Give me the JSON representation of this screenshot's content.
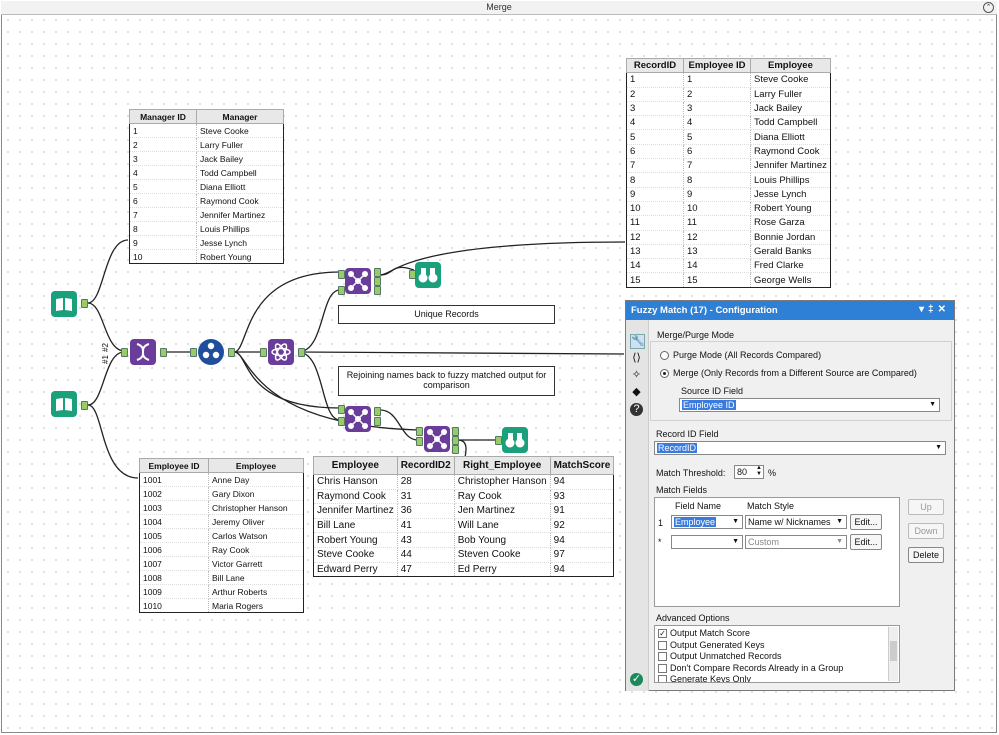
{
  "window": {
    "title": "Merge"
  },
  "manager_table": {
    "headers": [
      "Manager ID",
      "Manager"
    ],
    "rows": [
      [
        "1",
        "Steve Cooke"
      ],
      [
        "2",
        "Larry Fuller"
      ],
      [
        "3",
        "Jack Bailey"
      ],
      [
        "4",
        "Todd Campbell"
      ],
      [
        "5",
        "Diana Elliott"
      ],
      [
        "6",
        "Raymond Cook"
      ],
      [
        "7",
        "Jennifer Martinez"
      ],
      [
        "8",
        "Louis Phillips"
      ],
      [
        "9",
        "Jesse Lynch"
      ],
      [
        "10",
        "Robert Young"
      ]
    ]
  },
  "employee_table": {
    "headers": [
      "Employee ID",
      "Employee"
    ],
    "rows": [
      [
        "1001",
        "Anne Day"
      ],
      [
        "1002",
        "Gary Dixon"
      ],
      [
        "1003",
        "Christopher Hanson"
      ],
      [
        "1004",
        "Jeremy Oliver"
      ],
      [
        "1005",
        "Carlos Watson"
      ],
      [
        "1006",
        "Ray Cook"
      ],
      [
        "1007",
        "Victor Garrett"
      ],
      [
        "1008",
        "Bill Lane"
      ],
      [
        "1009",
        "Arthur Roberts"
      ],
      [
        "1010",
        "Maria Rogers"
      ]
    ]
  },
  "record_table": {
    "headers": [
      "RecordID",
      "Employee ID",
      "Employee"
    ],
    "rows": [
      [
        "1",
        "1",
        "Steve Cooke"
      ],
      [
        "2",
        "2",
        "Larry Fuller"
      ],
      [
        "3",
        "3",
        "Jack Bailey"
      ],
      [
        "4",
        "4",
        "Todd Campbell"
      ],
      [
        "5",
        "5",
        "Diana Elliott"
      ],
      [
        "6",
        "6",
        "Raymond Cook"
      ],
      [
        "7",
        "7",
        "Jennifer Martinez"
      ],
      [
        "8",
        "8",
        "Louis Phillips"
      ],
      [
        "9",
        "9",
        "Jesse Lynch"
      ],
      [
        "10",
        "10",
        "Robert Young"
      ],
      [
        "11",
        "11",
        "Rose Garza"
      ],
      [
        "12",
        "12",
        "Bonnie Jordan"
      ],
      [
        "13",
        "13",
        "Gerald Banks"
      ],
      [
        "14",
        "14",
        "Fred Clarke"
      ],
      [
        "15",
        "15",
        "George Wells"
      ]
    ]
  },
  "match_table": {
    "headers": [
      "Employee",
      "RecordID2",
      "Right_Employee",
      "MatchScore"
    ],
    "rows": [
      [
        "Chris Hanson",
        "28",
        "Christopher Hanson",
        "94"
      ],
      [
        "Raymond Cook",
        "31",
        "Ray Cook",
        "93"
      ],
      [
        "Jennifer Martinez",
        "36",
        "Jen Martinez",
        "91"
      ],
      [
        "Bill Lane",
        "41",
        "Will Lane",
        "92"
      ],
      [
        "Robert Young",
        "43",
        "Bob Young",
        "94"
      ],
      [
        "Steve Cooke",
        "44",
        "Steven Cooke",
        "97"
      ],
      [
        "Edward Perry",
        "47",
        "Ed Perry",
        "94"
      ]
    ]
  },
  "notes": {
    "unique": "Unique Records",
    "rejoin": "Rejoining names back to fuzzy matched output for comparison"
  },
  "union_labels": {
    "a": "#2",
    "b": "#1"
  },
  "tool_icons": [
    "book-input-icon",
    "book-input-icon",
    "dna-record-id-icon",
    "numbered-circle-icon",
    "atom-fuzzy-match-icon",
    "join-icon",
    "binoculars-browse-icon"
  ],
  "config": {
    "title": "Fuzzy Match (17) - Configuration",
    "header_buttons": [
      "▾",
      "‡",
      "✕"
    ],
    "merge_purge_label": "Merge/Purge Mode",
    "purge_option": "Purge Mode (All Records Compared)",
    "merge_option": "Merge (Only Records from a Different Source are Compared)",
    "source_id_label": "Source ID Field",
    "source_id_value": "Employee ID",
    "record_id_label": "Record ID Field",
    "record_id_value": "RecordID",
    "match_threshold_label": "Match Threshold:",
    "match_threshold_value": "80",
    "match_threshold_unit": "%",
    "match_fields_label": "Match Fields",
    "grid_headers": [
      "Field Name",
      "Match Style"
    ],
    "grid_rows": [
      {
        "marker": "1",
        "field": "Employee",
        "style": "Name w/ Nicknames",
        "edit": "Edit..."
      },
      {
        "marker": "*",
        "field": "",
        "style": "Custom",
        "edit": "Edit..."
      }
    ],
    "up_label": "Up",
    "down_label": "Down",
    "delete_label": "Delete",
    "advanced_label": "Advanced Options",
    "advanced_options": [
      {
        "label": "Output Match Score",
        "checked": true
      },
      {
        "label": "Output Generated Keys",
        "checked": false
      },
      {
        "label": "Output Unmatched Records",
        "checked": false
      },
      {
        "label": "Don't Compare Records Already in a Group",
        "checked": false
      },
      {
        "label": "Generate Keys Only",
        "checked": false
      }
    ]
  }
}
